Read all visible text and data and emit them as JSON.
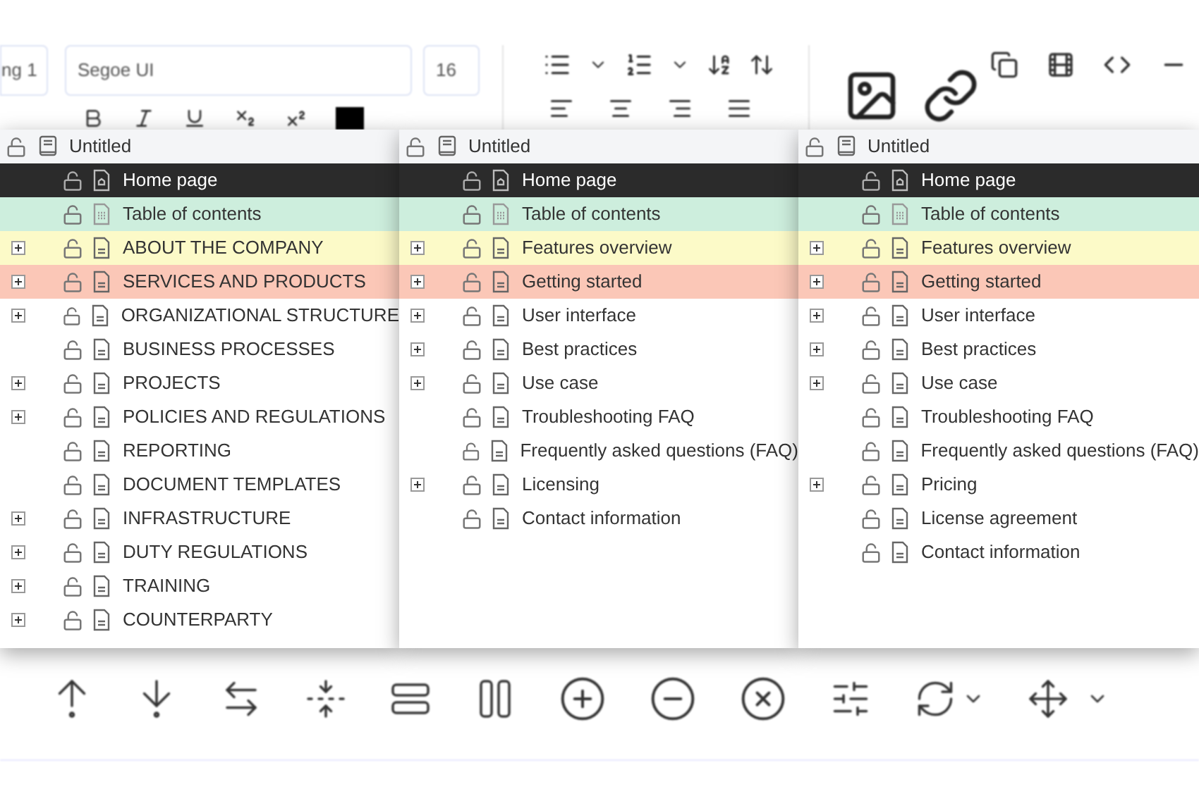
{
  "toolbar": {
    "style_field": "ng 1",
    "font_field": "Segoe UI",
    "size_field": "16"
  },
  "panels": [
    {
      "root": {
        "label": "Untitled",
        "children": [
          {
            "label": "Home page",
            "kind": "home",
            "selected": true,
            "expandable": false
          },
          {
            "label": "Table of contents",
            "kind": "toc",
            "selected": false,
            "expandable": false,
            "color": "#cdeedd"
          },
          {
            "label": "ABOUT THE COMPANY",
            "kind": "page",
            "selected": false,
            "expandable": true,
            "color": "#fcfac8"
          },
          {
            "label": "SERVICES AND PRODUCTS",
            "kind": "page",
            "selected": false,
            "expandable": true,
            "color": "#fbc7b7"
          },
          {
            "label": "ORGANIZATIONAL STRUCTURE",
            "kind": "page",
            "selected": false,
            "expandable": true
          },
          {
            "label": "BUSINESS PROCESSES",
            "kind": "page",
            "selected": false,
            "expandable": false
          },
          {
            "label": "PROJECTS",
            "kind": "page",
            "selected": false,
            "expandable": true
          },
          {
            "label": "POLICIES AND REGULATIONS",
            "kind": "page",
            "selected": false,
            "expandable": true
          },
          {
            "label": "REPORTING",
            "kind": "page",
            "selected": false,
            "expandable": false
          },
          {
            "label": "DOCUMENT TEMPLATES",
            "kind": "page",
            "selected": false,
            "expandable": false
          },
          {
            "label": "INFRASTRUCTURE",
            "kind": "page",
            "selected": false,
            "expandable": true
          },
          {
            "label": "DUTY REGULATIONS",
            "kind": "page",
            "selected": false,
            "expandable": true
          },
          {
            "label": "TRAINING",
            "kind": "page",
            "selected": false,
            "expandable": true
          },
          {
            "label": "COUNTERPARTY",
            "kind": "page",
            "selected": false,
            "expandable": true
          }
        ]
      }
    },
    {
      "root": {
        "label": "Untitled",
        "children": [
          {
            "label": "Home page",
            "kind": "home",
            "selected": true,
            "expandable": false
          },
          {
            "label": "Table of contents",
            "kind": "toc",
            "selected": false,
            "expandable": false,
            "color": "#cdeedd"
          },
          {
            "label": "Features overview",
            "kind": "page",
            "selected": false,
            "expandable": true,
            "color": "#fcfac8"
          },
          {
            "label": "Getting started",
            "kind": "page",
            "selected": false,
            "expandable": true,
            "color": "#fbc7b7"
          },
          {
            "label": "User interface",
            "kind": "page",
            "selected": false,
            "expandable": true
          },
          {
            "label": "Best practices",
            "kind": "page",
            "selected": false,
            "expandable": true
          },
          {
            "label": "Use case",
            "kind": "page",
            "selected": false,
            "expandable": true
          },
          {
            "label": "Troubleshooting FAQ",
            "kind": "page",
            "selected": false,
            "expandable": false
          },
          {
            "label": "Frequently asked questions (FAQ)",
            "kind": "page",
            "selected": false,
            "expandable": false
          },
          {
            "label": "Licensing",
            "kind": "page",
            "selected": false,
            "expandable": true
          },
          {
            "label": "Contact information",
            "kind": "page",
            "selected": false,
            "expandable": false
          }
        ]
      }
    },
    {
      "root": {
        "label": "Untitled",
        "children": [
          {
            "label": "Home page",
            "kind": "home",
            "selected": true,
            "expandable": false
          },
          {
            "label": "Table of contents",
            "kind": "toc",
            "selected": false,
            "expandable": false,
            "color": "#cdeedd"
          },
          {
            "label": "Features overview",
            "kind": "page",
            "selected": false,
            "expandable": true,
            "color": "#fcfac8"
          },
          {
            "label": "Getting started",
            "kind": "page",
            "selected": false,
            "expandable": true,
            "color": "#fbc7b7"
          },
          {
            "label": "User interface",
            "kind": "page",
            "selected": false,
            "expandable": true
          },
          {
            "label": "Best practices",
            "kind": "page",
            "selected": false,
            "expandable": true
          },
          {
            "label": "Use case",
            "kind": "page",
            "selected": false,
            "expandable": true
          },
          {
            "label": "Troubleshooting FAQ",
            "kind": "page",
            "selected": false,
            "expandable": false
          },
          {
            "label": "Frequently asked questions (FAQ)",
            "kind": "page",
            "selected": false,
            "expandable": false
          },
          {
            "label": "Pricing",
            "kind": "page",
            "selected": false,
            "expandable": true
          },
          {
            "label": "License agreement",
            "kind": "page",
            "selected": false,
            "expandable": false
          },
          {
            "label": "Contact information",
            "kind": "page",
            "selected": false,
            "expandable": false
          }
        ]
      }
    }
  ]
}
